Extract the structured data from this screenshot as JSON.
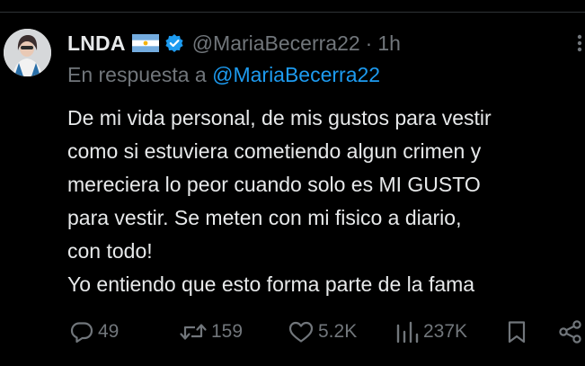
{
  "tweet": {
    "display_name": "LNDA",
    "handle": "@MariaBecerra22",
    "separator": "·",
    "time": "1h",
    "reply_prefix": "En respuesta a",
    "reply_to": "@MariaBecerra22",
    "lines": [
      "De mi vida personal, de mis gustos para vestir",
      "como si estuviera cometiendo algun crimen y",
      "mereciera lo peor cuando solo es MI GUSTO",
      "para vestir. Se meten con mi fisico a diario,",
      "con todo!",
      "Yo entiendo que esto forma parte de la fama"
    ]
  },
  "actions": {
    "replies": "49",
    "reposts": "159",
    "likes": "5.2K",
    "views": "237K"
  },
  "icons": {
    "flag": "argentina-flag-icon",
    "verified": "verified-badge-icon",
    "more": "more-icon",
    "reply": "reply-icon",
    "repost": "repost-icon",
    "like": "heart-icon",
    "views": "views-icon",
    "bookmark": "bookmark-icon",
    "share": "share-icon"
  },
  "colors": {
    "background": "#000000",
    "text": "#e7e9ea",
    "secondary": "#71767b",
    "accent": "#1d9bf0"
  }
}
